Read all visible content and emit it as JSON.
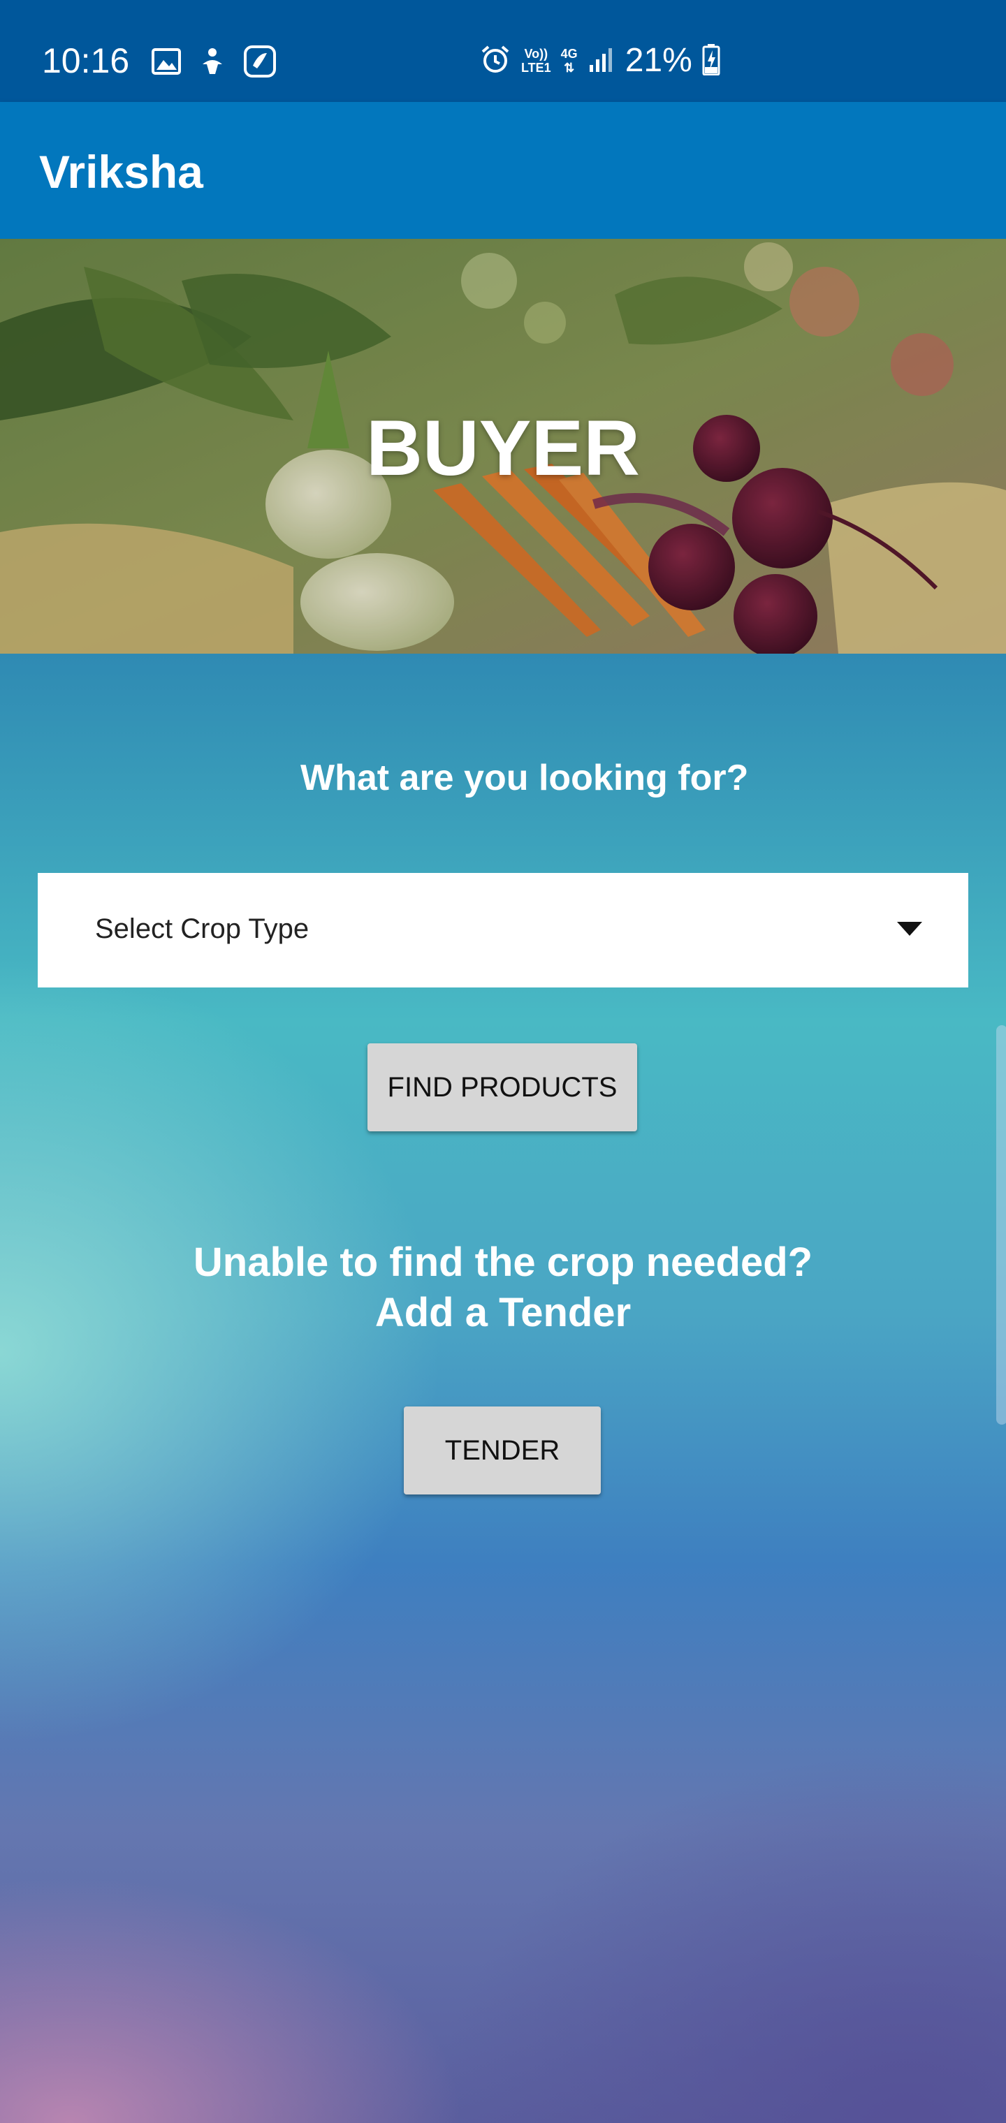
{
  "status_bar": {
    "time": "10:16",
    "battery_percent": "21%",
    "volte_top": "Vo))",
    "volte_bottom": "LTE1",
    "network_label": "4G",
    "icons": [
      "image-icon",
      "accessibility-icon",
      "saavn-icon",
      "alarm-icon",
      "volte-icon",
      "network-4g-icon",
      "signal-icon",
      "battery-charging-icon"
    ]
  },
  "app_bar": {
    "title": "Vriksha"
  },
  "hero": {
    "title": "BUYER"
  },
  "main": {
    "question": "What are you looking for?",
    "crop_select": {
      "value": "Select Crop Type"
    },
    "find_products_label": "FIND PRODUCTS",
    "unable_line1": "Unable to find the crop needed?",
    "unable_line2": "Add a Tender",
    "tender_label": "TENDER"
  },
  "colors": {
    "status_bar": "#00579b",
    "app_bar": "#0277bd",
    "button": "#d6d6d6"
  }
}
